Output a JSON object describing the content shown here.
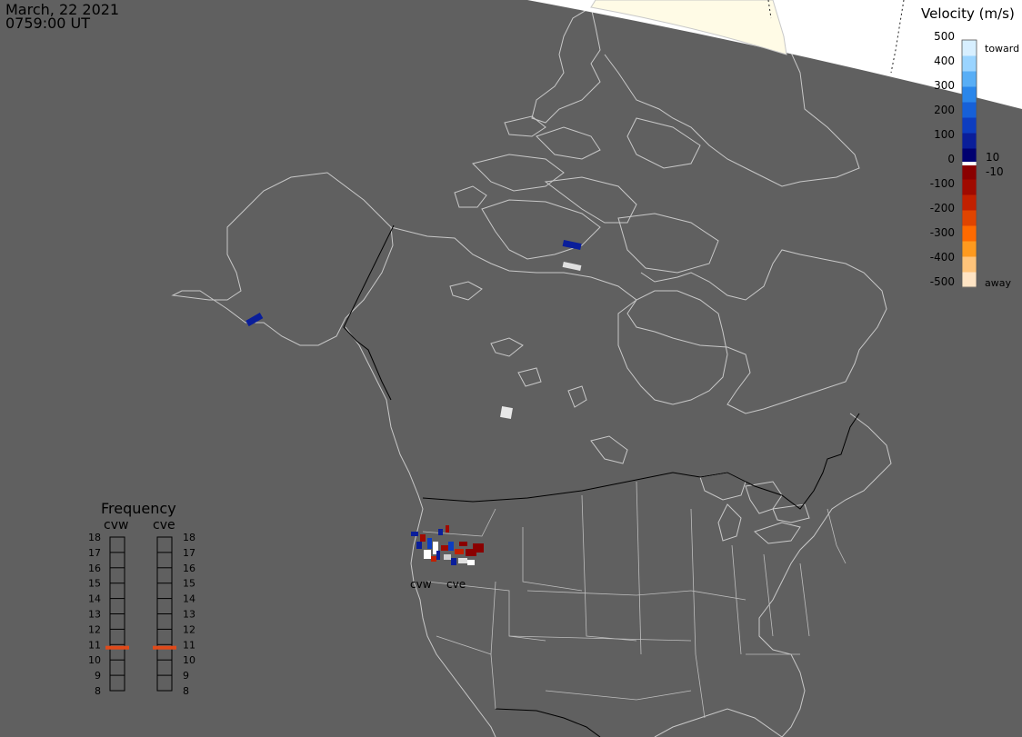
{
  "header": {
    "date": "March, 22 2021",
    "time": "0759:00 UT"
  },
  "colors": {
    "background_day": "#ffffff",
    "night": "#606060",
    "ice": "#fffbe6",
    "coast": "#c8c8c8"
  },
  "velocity_scale": {
    "title": "Velocity (m/s)",
    "ticks": [
      "500",
      "400",
      "300",
      "200",
      "100",
      "0",
      "-100",
      "-200",
      "-300",
      "-400",
      "-500"
    ],
    "inner_labels": [
      "10",
      "-10"
    ],
    "toward_label": "toward",
    "away_label": "away",
    "colors": [
      "#ffe4c4",
      "#ffc47a",
      "#ff9a1e",
      "#ff6a00",
      "#e04400",
      "#c22000",
      "#a00a00",
      "#8a0000",
      "#000070",
      "#0a1e9a",
      "#0d3dc0",
      "#1660d8",
      "#2a86ea",
      "#58aef6",
      "#9ad4ff",
      "#d7efff"
    ]
  },
  "frequency_panel": {
    "title": "Frequency",
    "radars": [
      "cvw",
      "cve"
    ],
    "levels": [
      "18",
      "17",
      "16",
      "15",
      "14",
      "13",
      "12",
      "11",
      "10",
      "9",
      "8"
    ],
    "cvw_value": 10.8,
    "cve_value": 10.8,
    "marker_color": "#e04a1a"
  },
  "radar_labels": {
    "cvw": "cvw",
    "cve": "cve"
  }
}
